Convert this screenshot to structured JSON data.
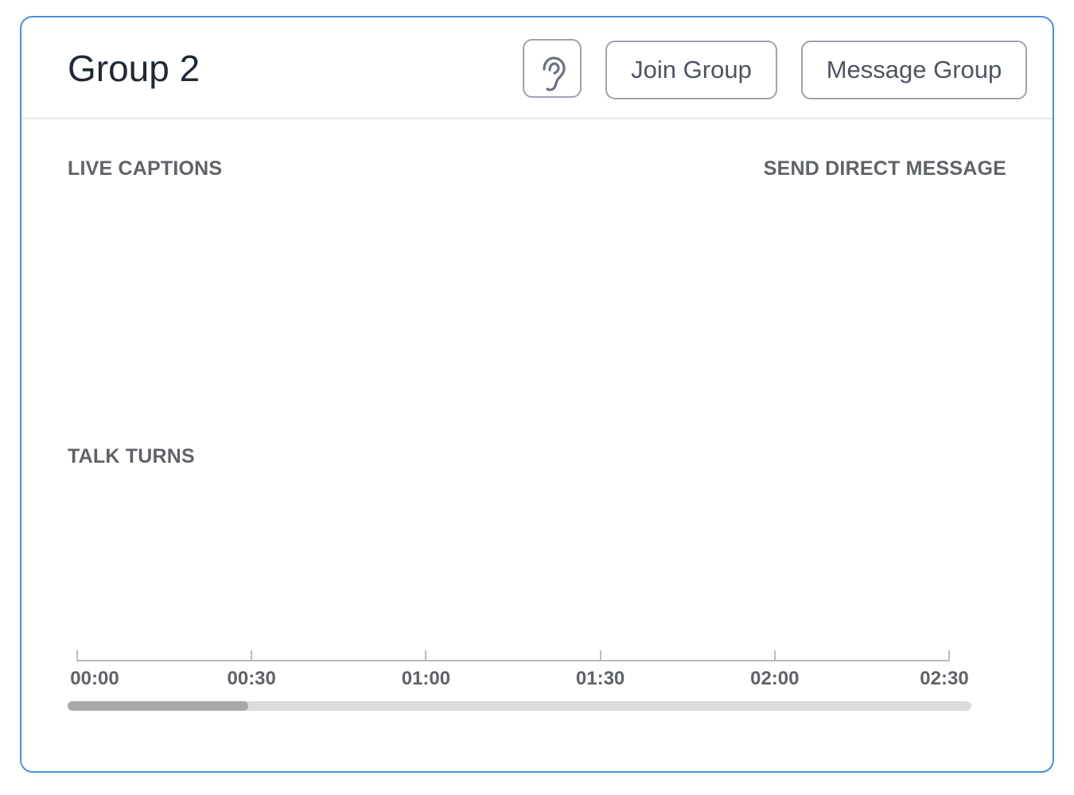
{
  "header": {
    "title": "Group 2",
    "listen_icon": "ear-icon",
    "join_label": "Join Group",
    "message_label": "Message Group"
  },
  "sections": {
    "live_captions": "LIVE CAPTIONS",
    "send_direct_message": "SEND DIRECT MESSAGE",
    "talk_turns": "TALK TURNS"
  },
  "timeline": {
    "ticks": [
      "00:00",
      "00:30",
      "01:00",
      "01:30",
      "02:00",
      "02:30"
    ],
    "scroll_position_fraction": 0.2
  },
  "colors": {
    "card_border": "#4a90d9",
    "text_dark": "#1f2937",
    "label_gray": "#5f6368"
  }
}
